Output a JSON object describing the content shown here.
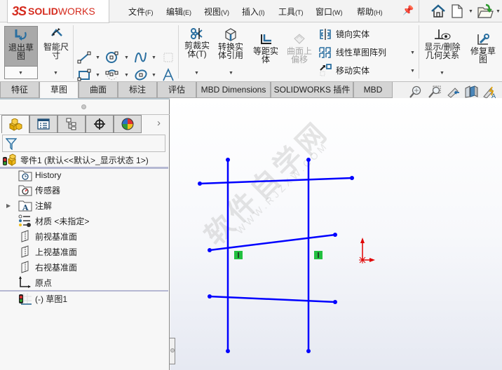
{
  "app": {
    "logo_prefix": "3S",
    "logo_bold": "SOLID",
    "logo_light": "WORKS"
  },
  "menu": [
    {
      "label": "文件",
      "key": "(F)"
    },
    {
      "label": "编辑",
      "key": "(E)"
    },
    {
      "label": "视图",
      "key": "(V)"
    },
    {
      "label": "插入",
      "key": "(I)"
    },
    {
      "label": "工具",
      "key": "(T)"
    },
    {
      "label": "窗口",
      "key": "(W)"
    },
    {
      "label": "帮助",
      "key": "(H)"
    }
  ],
  "quick_access": {
    "icons": [
      "pin-icon",
      "home-icon",
      "new-document-icon",
      "open-document-icon"
    ]
  },
  "ribbon": {
    "exit_sketch": {
      "line1": "退出草",
      "line2": "图"
    },
    "smart_dimension": {
      "line1": "智能尺",
      "line2": "寸"
    },
    "trim": {
      "line1": "剪裁实",
      "line2": "体(T)"
    },
    "convert": {
      "line1": "转换实",
      "line2": "体引用"
    },
    "offset": {
      "line1": "等距实",
      "line2": "体"
    },
    "surface_offset": {
      "line1": "曲面上",
      "line2": "偏移"
    },
    "mirror": "镜向实体",
    "linear_pattern": "线性草图阵列",
    "move": "移动实体",
    "display_relations": {
      "line1": "显示/删除",
      "line2": "几何关系"
    },
    "repair_sketch": {
      "line1": "修复草",
      "line2": "图"
    }
  },
  "tabs": [
    {
      "label": "特征",
      "active": false
    },
    {
      "label": "草图",
      "active": true
    },
    {
      "label": "曲面",
      "active": false
    },
    {
      "label": "标注",
      "active": false
    },
    {
      "label": "评估",
      "active": false
    },
    {
      "label": "MBD Dimensions",
      "active": false
    },
    {
      "label": "SOLIDWORKS 插件",
      "active": false
    },
    {
      "label": "MBD",
      "active": false
    }
  ],
  "feature_tree": {
    "root": "零件1  (默认<<默认>_显示状态 1>)",
    "items": [
      {
        "label": "History",
        "icon": "history-folder-icon",
        "expandable": false
      },
      {
        "label": "传感器",
        "icon": "sensor-folder-icon",
        "expandable": false
      },
      {
        "label": "注解",
        "icon": "annotation-folder-icon",
        "expandable": true
      },
      {
        "label": "材质 <未指定>",
        "icon": "material-icon",
        "expandable": false
      },
      {
        "label": "前视基准面",
        "icon": "plane-icon",
        "expandable": false
      },
      {
        "label": "上视基准面",
        "icon": "plane-icon",
        "expandable": false
      },
      {
        "label": "右视基准面",
        "icon": "plane-icon",
        "expandable": false
      },
      {
        "label": "原点",
        "icon": "origin-icon",
        "expandable": false
      }
    ],
    "sketch": "(-) 草图1"
  },
  "viewport": {
    "watermark": "软件自学网",
    "watermark_url": "WWW.RJZXW.COM",
    "sketch_color": "#0000ff",
    "relation_color": "#22c040",
    "origin_color": "#e00000"
  }
}
